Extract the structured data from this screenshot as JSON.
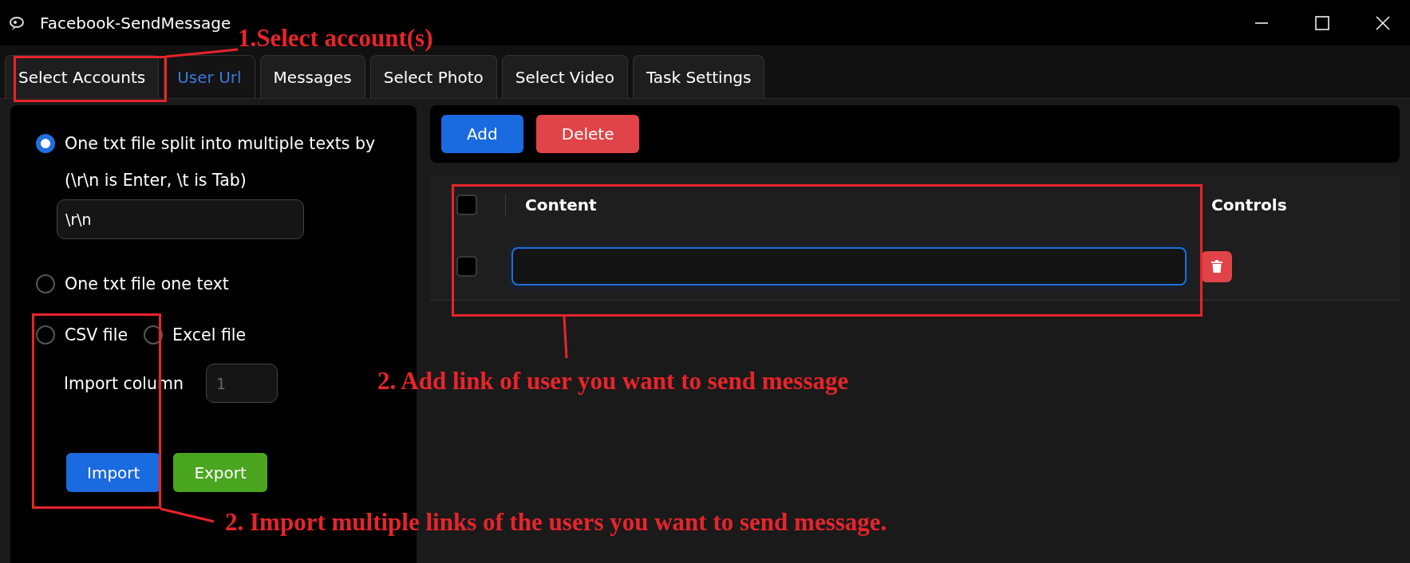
{
  "window": {
    "title": "Facebook-SendMessage"
  },
  "tabs": [
    {
      "label": "Select Accounts",
      "selected": false
    },
    {
      "label": "User Url",
      "selected": true
    },
    {
      "label": "Messages",
      "selected": false
    },
    {
      "label": "Select Photo",
      "selected": false
    },
    {
      "label": "Select Video",
      "selected": false
    },
    {
      "label": "Task Settings",
      "selected": false
    }
  ],
  "import_panel": {
    "split_option": {
      "label": "One txt file split into multiple texts by",
      "hint": "(\\r\\n is Enter, \\t is Tab)",
      "selected": true
    },
    "separator": {
      "value": "\\r\\n"
    },
    "single_option": {
      "label": "One txt file one text",
      "selected": false
    },
    "file_types": [
      {
        "label": "CSV file",
        "selected": false
      },
      {
        "label": "Excel file",
        "selected": false
      }
    ],
    "import_column": {
      "label": "Import column",
      "placeholder": "1"
    },
    "buttons": [
      {
        "label": "Import",
        "kind": "primary"
      },
      {
        "label": "Export",
        "kind": "success"
      }
    ]
  },
  "toolbar": {
    "buttons": [
      {
        "label": "Add",
        "kind": "primary"
      },
      {
        "label": "Delete",
        "kind": "danger"
      }
    ]
  },
  "table": {
    "select_all_checked": false,
    "columns": [
      "Content",
      "Controls"
    ],
    "rows": [
      {
        "checked": false,
        "focused": true
      }
    ]
  },
  "annotations": [
    {
      "text": "1.Select account(s)"
    },
    {
      "text": "2. Add link of user you want to send message"
    },
    {
      "text": "2. Import multiple links of the users you want to send message."
    }
  ]
}
